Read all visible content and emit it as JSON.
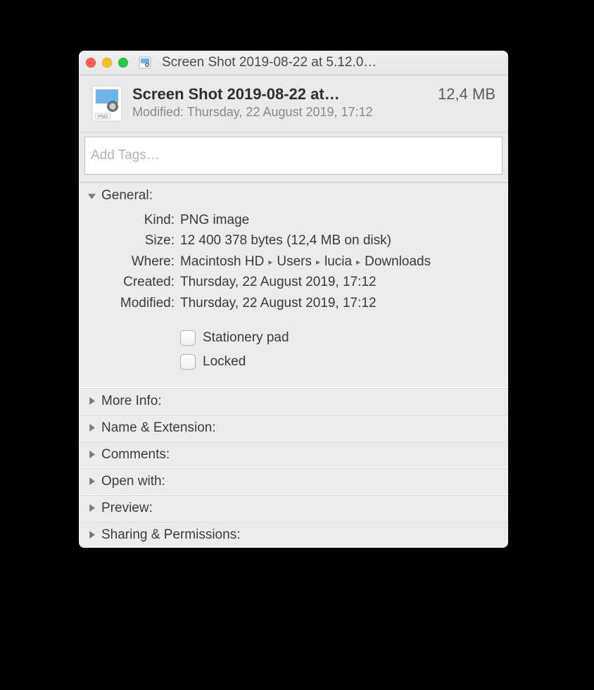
{
  "titlebar": {
    "title": "Screen Shot 2019-08-22 at 5.12.0…"
  },
  "summary": {
    "file_name": "Screen Shot 2019-08-22 at…",
    "file_size": "12,4 MB",
    "modified_label": "Modified:",
    "modified_value": "Thursday, 22 August 2019, 17:12"
  },
  "tags": {
    "placeholder": "Add Tags…"
  },
  "general": {
    "title": "General:",
    "kind_label": "Kind:",
    "kind_value": "PNG image",
    "size_label": "Size:",
    "size_value": "12 400 378 bytes (12,4 MB on disk)",
    "where_label": "Where:",
    "where_parts": [
      "Macintosh HD",
      "Users",
      "lucia",
      "Downloads"
    ],
    "created_label": "Created:",
    "created_value": "Thursday, 22 August 2019, 17:12",
    "modified_label": "Modified:",
    "modified_value": "Thursday, 22 August 2019, 17:12",
    "stationery_label": "Stationery pad",
    "locked_label": "Locked"
  },
  "sections": {
    "more_info": "More Info:",
    "name_ext": "Name & Extension:",
    "comments": "Comments:",
    "open_with": "Open with:",
    "preview": "Preview:",
    "sharing": "Sharing & Permissions:"
  },
  "icon_badge": "PNG"
}
